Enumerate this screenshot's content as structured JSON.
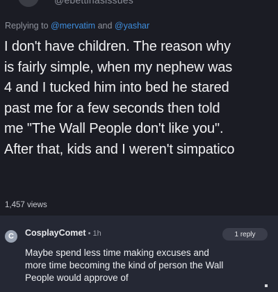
{
  "header": {
    "handle": "@ebettinasissues"
  },
  "tweet": {
    "replying_prefix": "Replying to ",
    "mention_1": "@mervatim",
    "and": " and ",
    "mention_2": "@yashar",
    "body": "I don't have children. The reason why\nis fairly simple, when my nephew was\n4 and I tucked him into bed he stared\npast me for a few seconds then told\nme \"The Wall People don't like you\".\nAfter that, kids and I weren't simpatico",
    "views": "1,457 views"
  },
  "comment": {
    "avatar_letter": "C",
    "username": "CosplayComet",
    "separator": " • ",
    "time": "1h",
    "reply_label": "1 reply",
    "text": "Maybe spend less time making excuses and\nmore time becoming the kind of person the Wall\nPeople would approve of"
  },
  "colors": {
    "background": "#1b1c24",
    "comment_background": "#252834",
    "mention": "#3e8ede",
    "text_primary": "#f1f1f3",
    "text_secondary": "#8f939d"
  }
}
